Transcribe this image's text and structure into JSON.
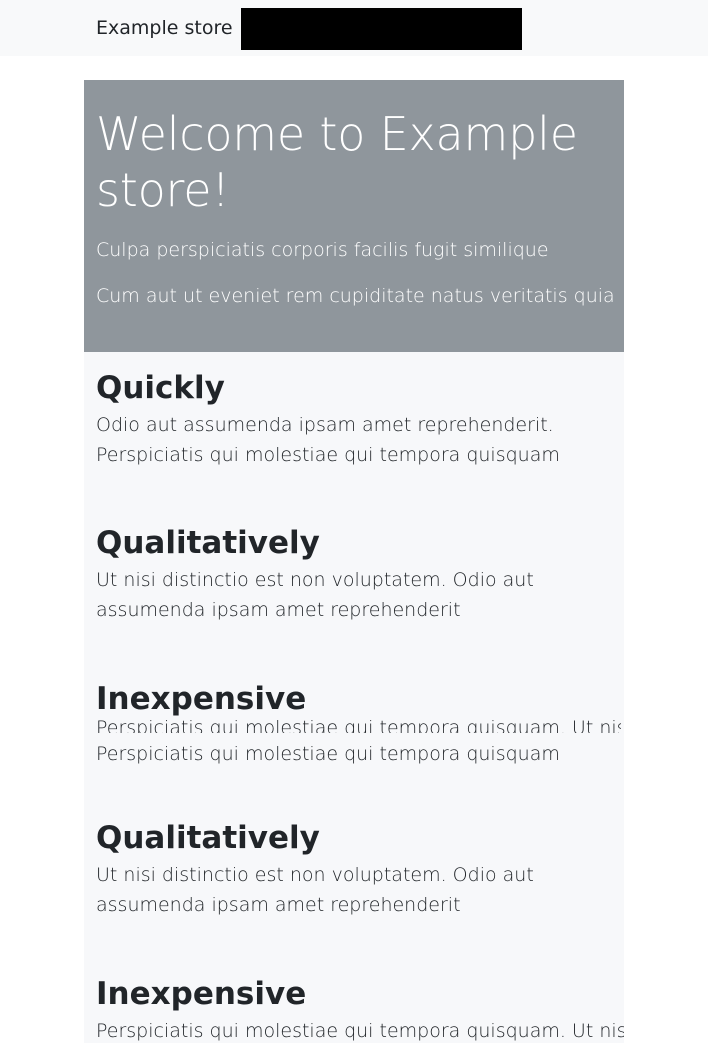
{
  "navbar": {
    "brand": "Example store",
    "search_value": ""
  },
  "hero": {
    "title": "Welcome to Example store!",
    "line1": "Culpa perspiciatis corporis facilis fugit similique",
    "line2": "Cum aut ut eveniet rem cupiditate natus veritatis quia"
  },
  "features": [
    {
      "title": "Quickly",
      "text": "Odio aut assumenda ipsam amet reprehenderit. Perspiciatis qui molestiae qui tempora quisquam"
    },
    {
      "title": "Qualitatively",
      "text": "Ut nisi distinctio est non voluptatem. Odio aut assumenda ipsam amet reprehenderit"
    },
    {
      "title": "Inexpensive",
      "text": "Perspiciatis qui molestiae qui tempora quisquam. Ut nisi",
      "overlap_text": "Perspiciatis qui molestiae qui tempora quisquam"
    },
    {
      "title": "Qualitatively",
      "text": "Ut nisi distinctio est non voluptatem. Odio aut assumenda ipsam amet reprehenderit"
    },
    {
      "title": "Inexpensive",
      "text": "Perspiciatis qui molestiae qui tempora quisquam. Ut nisi"
    }
  ]
}
